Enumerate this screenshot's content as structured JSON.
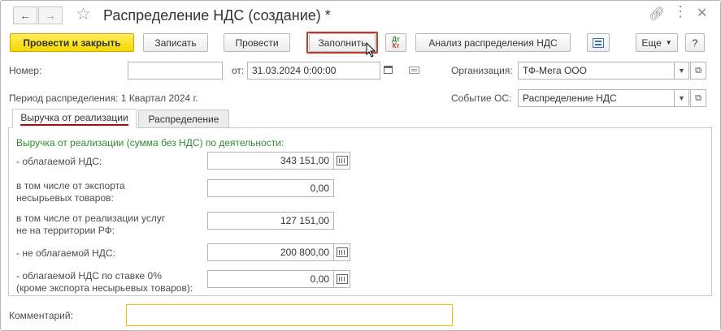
{
  "window": {
    "title": "Распределение НДС (создание) *"
  },
  "toolbar": {
    "post_and_close": "Провести и закрыть",
    "save": "Записать",
    "post": "Провести",
    "fill": "Заполнить",
    "dt_kt": "Дт Кт",
    "analysis": "Анализ распределения НДС",
    "more": "Еще",
    "help": "?"
  },
  "header": {
    "number_label": "Номер:",
    "number_value": "",
    "date_label": "от:",
    "date_value": "31.03.2024  0:00:00",
    "org_label": "Организация:",
    "org_value": "ТФ-Мега ООО",
    "period_label": "Период распределения: 1 Квартал 2024  г.",
    "event_label": "Событие ОС:",
    "event_value": "Распределение НДС"
  },
  "tabs": [
    {
      "label": "Выручка от реализации",
      "active": true
    },
    {
      "label": "Распределение",
      "active": false
    }
  ],
  "revenue": {
    "section_title": "Выручка от реализации (сумма без НДС) по деятельности:",
    "rows": [
      {
        "label": "- облагаемой НДС:",
        "value": "343 151,00"
      },
      {
        "label": "в том числе от экспорта\nнесырьевых товаров:",
        "value": "0,00"
      },
      {
        "label": "в том числе от реализации услуг\nне на территории РФ:",
        "value": "127 151,00"
      },
      {
        "label": "- не облагаемой НДС:",
        "value": "200 800,00"
      },
      {
        "label": "- облагаемой НДС по ставке 0%\n(кроме экспорта несырьевых товаров):",
        "value": "0,00"
      }
    ]
  },
  "footer": {
    "comment_label": "Комментарий:",
    "comment_value": ""
  },
  "colors": {
    "accent_yellow": "#f5d800",
    "section_green": "#2e8b2e",
    "tab_underline": "#cc0000",
    "highlight_red": "#c0392b"
  }
}
